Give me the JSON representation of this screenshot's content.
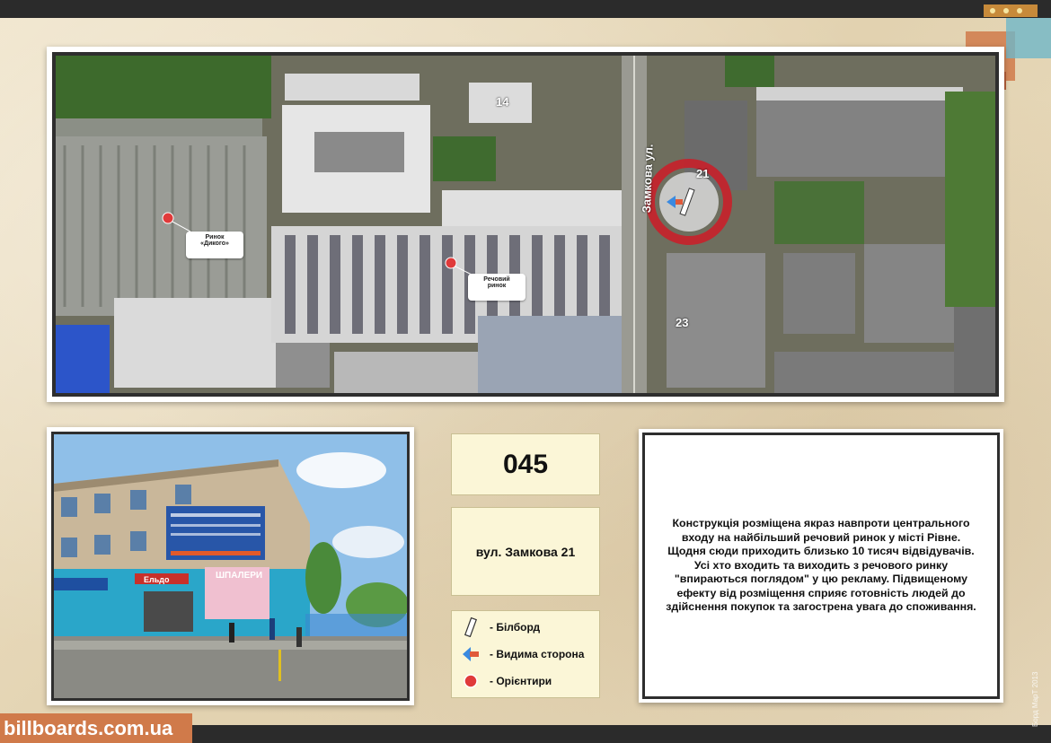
{
  "site": {
    "logo_text": "billboards.com.ua",
    "copyright": "Борд МарТ 2013"
  },
  "map": {
    "street_name": "Замкова ул.",
    "house_numbers": [
      "14",
      "21",
      "23"
    ],
    "landmarks": [
      {
        "label_line1": "Ринок",
        "label_line2": "«Дикого»"
      },
      {
        "label_line1": "Речовий",
        "label_line2": "ринок"
      }
    ]
  },
  "billboard": {
    "code": "045",
    "address": "вул. Замкова 21",
    "description": "Конструкція розміщена якраз навпроти центрального входу на найбільший речовий ринок у місті Рівне. Щодня сюди приходить близько 10 тисяч відвідувачів. Усі хто входить та виходить з речового ринку \"впираються поглядом\" у цю рекламу. Підвищеному ефекту від розміщення сприяє готовність людей до здійснення покупок та загострена увага до споживання."
  },
  "legend": {
    "billboard": "- Білборд",
    "visible_side": "- Видима сторона",
    "landmarks": "- Орієнтири"
  },
  "photo": {
    "sign_text": "ШПАЛЕРИ",
    "shop_text": "Ельдо"
  }
}
